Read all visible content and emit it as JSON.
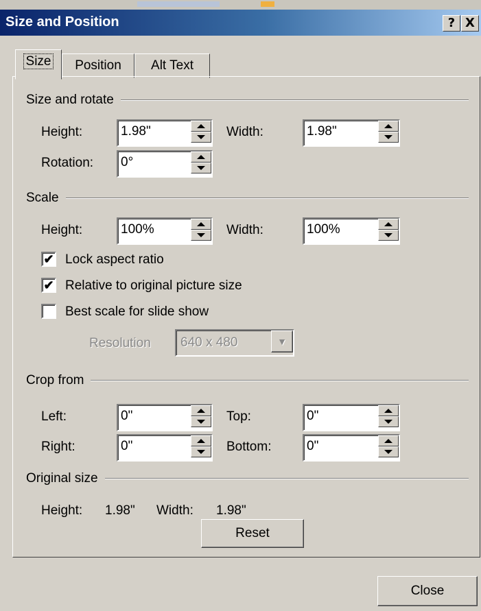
{
  "window": {
    "title": "Size and Position",
    "help_label": "?",
    "close_label": "X"
  },
  "tabs": [
    {
      "label": "Size"
    },
    {
      "label": "Position"
    },
    {
      "label": "Alt Text"
    }
  ],
  "size_rotate": {
    "heading": "Size and rotate",
    "height_label": "Height:",
    "height_value": "1.98\"",
    "width_label": "Width:",
    "width_value": "1.98\"",
    "rotation_label": "Rotation:",
    "rotation_value": "0°"
  },
  "scale": {
    "heading": "Scale",
    "height_label": "Height:",
    "height_value": "100%",
    "width_label": "Width:",
    "width_value": "100%",
    "lock_aspect_label": "Lock aspect ratio",
    "lock_aspect_checked": true,
    "relative_label": "Relative to original picture size",
    "relative_checked": true,
    "best_scale_label": "Best scale for slide show",
    "best_scale_checked": false,
    "resolution_label": "Resolution",
    "resolution_value": "640 x 480"
  },
  "crop": {
    "heading": "Crop from",
    "left_label": "Left:",
    "left_value": "0\"",
    "top_label": "Top:",
    "top_value": "0\"",
    "right_label": "Right:",
    "right_value": "0\"",
    "bottom_label": "Bottom:",
    "bottom_value": "0\""
  },
  "original": {
    "heading": "Original size",
    "height_label": "Height:",
    "height_value": "1.98\"",
    "width_label": "Width:",
    "width_value": "1.98\"",
    "reset_label": "Reset"
  },
  "footer": {
    "close_label": "Close"
  },
  "check_glyph": "✔",
  "dropdown_arrow": "▼"
}
